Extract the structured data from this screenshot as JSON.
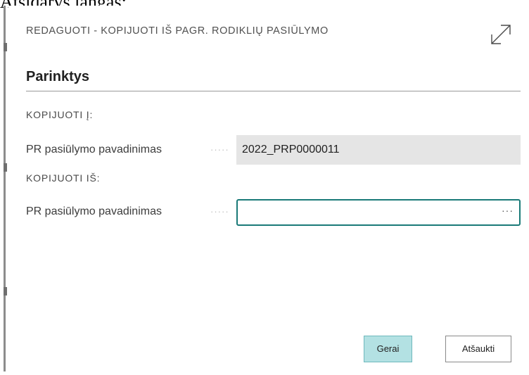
{
  "caption": "Atsidarys langas:",
  "dialog": {
    "title": "REDAGUOTI - KOPIJUOTI IŠ PAGR. RODIKLIŲ PASIŪLYMO",
    "expand_icon": "expand-diagonal-icon",
    "section": {
      "title": "Parinktys"
    },
    "copy_to": {
      "group_label": "KOPIJUOTI Į:",
      "field_label": "PR pasiūlymo pavadinimas",
      "dots": "·····",
      "value": "2022_PRP0000011"
    },
    "copy_from": {
      "group_label": "KOPIJUOTI IŠ:",
      "field_label": "PR pasiūlymo pavadinimas",
      "dots": "·····",
      "value": "",
      "lookup_label": "···"
    },
    "buttons": {
      "ok": "Gerai",
      "cancel": "Atšaukti"
    },
    "colors": {
      "accent": "#1a7a78",
      "ok_button_bg": "#b3e1e3",
      "readonly_bg": "#e5e5e5"
    }
  }
}
